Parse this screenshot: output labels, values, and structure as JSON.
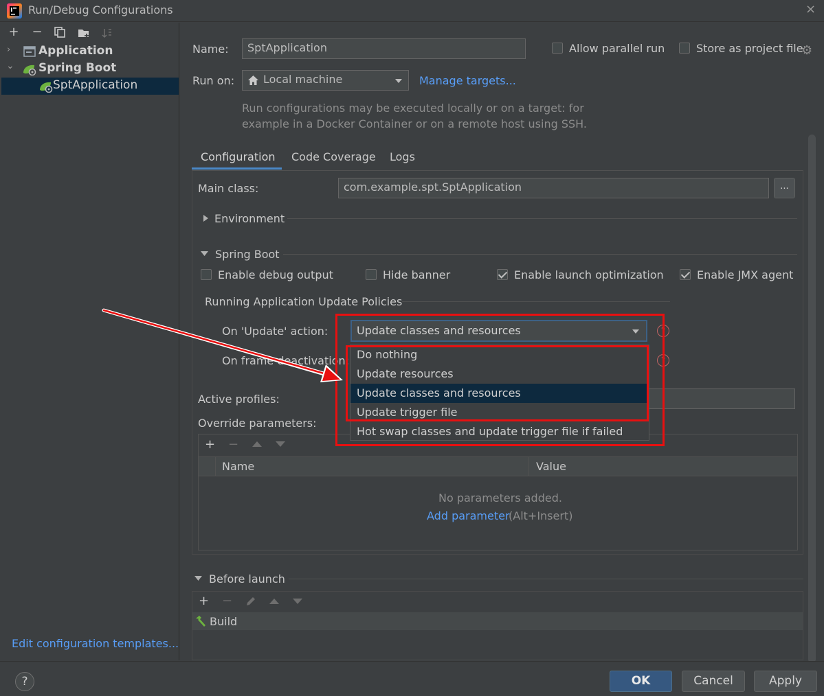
{
  "window": {
    "title": "Run/Debug Configurations",
    "close": "×"
  },
  "left": {
    "toolbar": [
      "+",
      "−"
    ],
    "tree": [
      {
        "label": "Application",
        "expanded": false
      },
      {
        "label": "Spring Boot",
        "expanded": true
      },
      {
        "label": "SptApplication",
        "selected": true
      }
    ],
    "edit_templates": "Edit configuration templates..."
  },
  "header": {
    "name_label": "Name:",
    "name_value": "SptApplication",
    "allow_parallel": "Allow parallel run",
    "store_as_file": "Store as project file",
    "run_on_label": "Run on:",
    "run_on_value": "Local machine",
    "manage_targets": "Manage targets...",
    "hint_line1": "Run configurations may be executed locally or on a target: for",
    "hint_line2": "example in a Docker Container or on a remote host using SSH."
  },
  "tabs": [
    "Configuration",
    "Code Coverage",
    "Logs"
  ],
  "config": {
    "main_class_label": "Main class:",
    "main_class_value": "com.example.spt.SptApplication",
    "browse": "...",
    "environment": "Environment",
    "spring_boot": "Spring Boot",
    "checks": [
      {
        "label": "Enable debug output",
        "checked": false
      },
      {
        "label": "Hide banner",
        "checked": false
      },
      {
        "label": "Enable launch optimization",
        "checked": true
      },
      {
        "label": "Enable JMX agent",
        "checked": true
      }
    ],
    "policies_title": "Running Application Update Policies",
    "on_update_label": "On 'Update' action:",
    "on_update_value": "Update classes and resources",
    "on_frame_label": "On frame deactivation:",
    "help": "?",
    "active_profiles_label": "Active profiles:",
    "override_label": "Override parameters:",
    "col_name": "Name",
    "col_value": "Value",
    "empty_text": "No parameters added.",
    "add_param": "Add parameter",
    "add_param_shortcut": "(Alt+Insert)"
  },
  "dropdown": {
    "options": [
      "Do nothing",
      "Update resources",
      "Update classes and resources",
      "Update trigger file",
      "Hot swap classes and update trigger file if failed"
    ],
    "selected_index": 2
  },
  "before_launch": {
    "title": "Before launch",
    "task": "Build"
  },
  "buttons": {
    "ok": "OK",
    "cancel": "Cancel",
    "apply": "Apply",
    "help": "?"
  },
  "colors": {
    "accent": "#589df6",
    "highlight": "#e81010",
    "selection": "#0d293e"
  }
}
